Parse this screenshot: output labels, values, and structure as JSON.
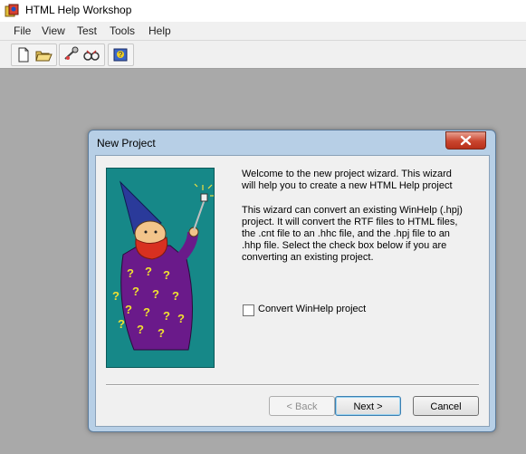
{
  "app": {
    "title": "HTML Help Workshop",
    "icon": "html-help-workshop-icon"
  },
  "menu": [
    "File",
    "View",
    "Test",
    "Tools",
    "Help"
  ],
  "toolbar": {
    "buttons": [
      "new-document-icon",
      "open-folder-icon",
      "compile-icon",
      "view-compiled-file-icon",
      "help-icon"
    ]
  },
  "dialog": {
    "title": "New Project",
    "close_icon": "close-icon",
    "intro_text": "Welcome to the new project wizard. This wizard will help you to create a new HTML Help project",
    "convert_text": "This wizard can convert an existing WinHelp (.hpj) project. It will convert the RTF files to HTML files, the .cnt file to an .hhc file, and the .hpj file to an .hhp file. Select the check box below if you are converting an existing project.",
    "checkbox": {
      "label": "Convert WinHelp project",
      "checked": false
    },
    "buttons": {
      "back": "< Back",
      "next": "Next >",
      "cancel": "Cancel"
    },
    "image": "wizard-illustration"
  },
  "colors": {
    "workspace": "#a9a9a9",
    "dialog_frame": "#b7cfe6",
    "wizard_background": "#168888",
    "close_button": "#c9452e"
  }
}
